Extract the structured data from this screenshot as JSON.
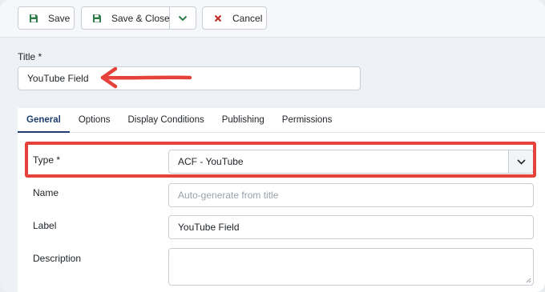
{
  "toolbar": {
    "save_label": "Save",
    "save_close_label": "Save & Close",
    "cancel_label": "Cancel"
  },
  "title_field": {
    "label": "Title *",
    "value": "YouTube Field"
  },
  "tabs": [
    {
      "label": "General",
      "active": true
    },
    {
      "label": "Options",
      "active": false
    },
    {
      "label": "Display Conditions",
      "active": false
    },
    {
      "label": "Publishing",
      "active": false
    },
    {
      "label": "Permissions",
      "active": false
    }
  ],
  "fields": {
    "type": {
      "label": "Type *",
      "value": "ACF - YouTube"
    },
    "name": {
      "label": "Name",
      "placeholder": "Auto-generate from title"
    },
    "label": {
      "label": "Label",
      "value": "YouTube Field"
    },
    "description": {
      "label": "Description",
      "value": ""
    }
  },
  "colors": {
    "save_icon": "#2f7d4a",
    "cancel_icon": "#c62828",
    "annotation": "#e5423b",
    "active_tab": "#1f3f6e"
  },
  "icons": {
    "save": "floppy-disk-icon",
    "save_close": "floppy-disk-icon",
    "dropdown": "chevron-down-icon",
    "cancel": "close-x-icon",
    "select": "chevron-down-icon"
  }
}
